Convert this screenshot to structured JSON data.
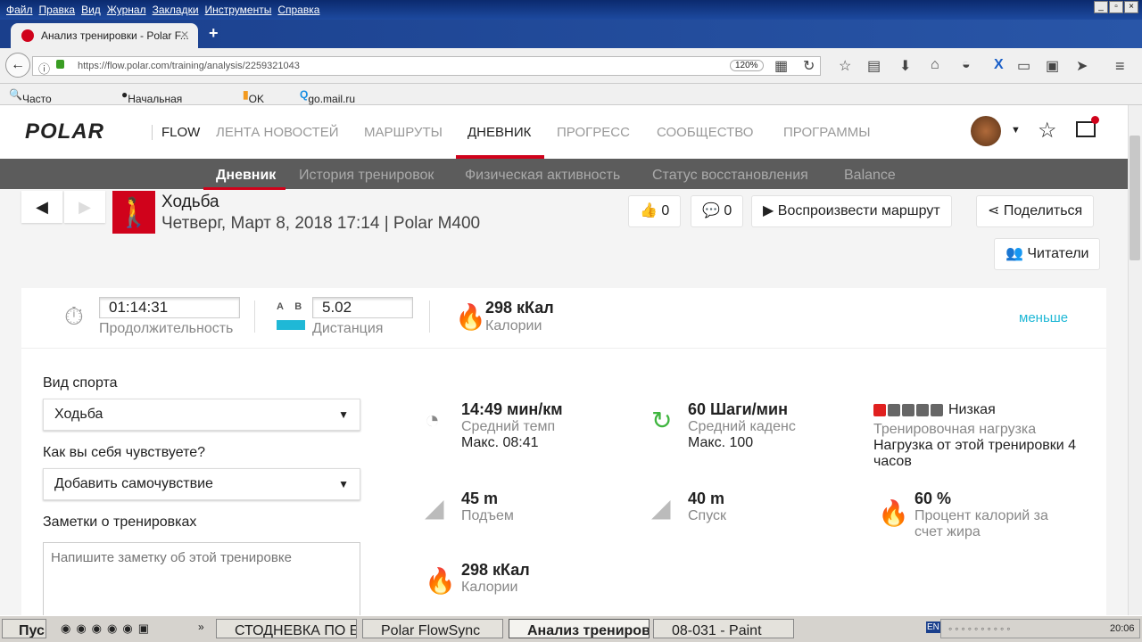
{
  "browser": {
    "menu": [
      "Файл",
      "Правка",
      "Вид",
      "Журнал",
      "Закладки",
      "Инструменты",
      "Справка"
    ],
    "tab_title": "Анализ тренировки - Polar F...",
    "url": "https://flow.polar.com/training/analysis/2259321043",
    "zoom": "120%",
    "bookmarks": [
      "Часто посещаемые",
      "Начальная страница",
      "OK Live",
      "go.mail.ru"
    ]
  },
  "site": {
    "logo": "POLAR",
    "flow": "FLOW",
    "nav": [
      "ЛЕНТА НОВОСТЕЙ",
      "МАРШРУТЫ",
      "ДНЕВНИК",
      "ПРОГРЕСС",
      "СООБЩЕСТВО",
      "ПРОГРАММЫ"
    ],
    "subnav": [
      "Дневник",
      "История тренировок",
      "Физическая активность",
      "Статус восстановления",
      "Balance"
    ]
  },
  "training": {
    "sport": "Ходьба",
    "date": "Четверг, Март 8, 2018 17:14 | Polar M400",
    "likes": "0",
    "comments": "0",
    "replay": "Воспроизвести маршрут",
    "share": "Поделиться",
    "readers": "Читатели"
  },
  "summary": {
    "duration": "01:14:31",
    "duration_label": "Продолжительность",
    "ab_a": "A",
    "ab_b": "B",
    "distance": "5.02",
    "distance_label": "Дистанция",
    "calories": "298 кКал",
    "calories_label": "Калории",
    "less": "меньше"
  },
  "form": {
    "sport_label": "Вид спорта",
    "sport_value": "Ходьба",
    "feel_label": "Как вы себя чувствуете?",
    "feel_value": "Добавить самочувствие",
    "notes_label": "Заметки о тренировках",
    "notes_placeholder": "Напишите заметку об этой тренировке"
  },
  "metrics": {
    "pace": "14:49 мин/км",
    "pace_label": "Средний темп",
    "pace_max": "Макс. 08:41",
    "cadence": "60 Шаги/мин",
    "cadence_label": "Средний каденс",
    "cadence_max": "Макс. 100",
    "load_level": "Низкая",
    "load_fraction": 0.2,
    "load_label": "Тренировочная нагрузка",
    "load_text": "Нагрузка от этой тренировки 4 часов",
    "ascent": "45 m",
    "ascent_label": "Подъем",
    "descent": "40 m",
    "descent_label": "Спуск",
    "fat": "60 %",
    "fat_label": "Процент калорий за счет жира",
    "calories": "298 кКал",
    "calories_label": "Калории"
  },
  "taskbar": {
    "start": "Пуск",
    "windows": [
      "СТОДНЕВКА ПО БЕГУ - ...",
      "Polar FlowSync",
      "Анализ тренировки - ...",
      "08-031 - Paint"
    ],
    "lang": "EN",
    "clock": "20:06"
  },
  "colors": {
    "accent": "#d0021b",
    "link": "#1fb8d6",
    "flame": "#f5a623"
  }
}
